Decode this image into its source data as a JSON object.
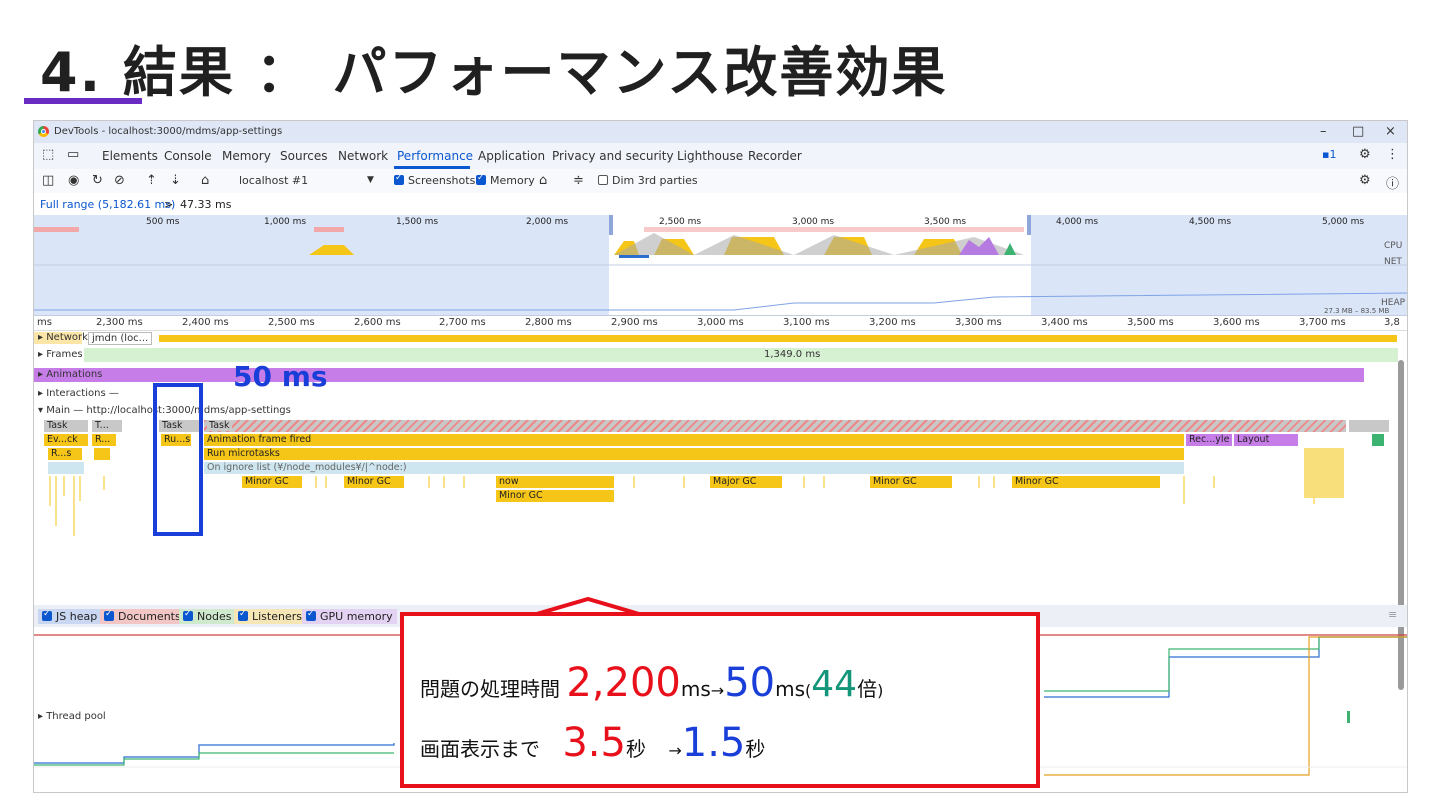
{
  "slide": {
    "title": "4. 結果 ： パフォーマンス改善効果"
  },
  "window": {
    "title": "DevTools - localhost:3000/mdms/app-settings",
    "minimize": "–",
    "maximize": "□",
    "close": "×"
  },
  "tabs": [
    "Elements",
    "Console",
    "Memory",
    "Sources",
    "Network",
    "Performance",
    "Application",
    "Privacy and security",
    "Lighthouse",
    "Recorder"
  ],
  "issues_badge": "1",
  "toolbar": {
    "target": "localhost #1",
    "screenshots": "Screenshots",
    "memory": "Memory",
    "dim_3rd": "Dim 3rd parties"
  },
  "range": {
    "full": "Full range (5,182.61 ms)",
    "sep": ">",
    "selected": "47.33 ms"
  },
  "overview": {
    "ticks": [
      "500 ms",
      "1,000 ms",
      "1,500 ms",
      "2,000 ms",
      "2,500 ms",
      "3,000 ms",
      "3,500 ms",
      "4,000 ms",
      "4,500 ms",
      "5,000 ms"
    ],
    "labels": {
      "cpu": "CPU",
      "net": "NET",
      "heap": "HEAP",
      "heap_range": "27.3 MB – 83.5 MB"
    }
  },
  "ruler": [
    "ms",
    "2,300 ms",
    "2,400 ms",
    "2,500 ms",
    "2,600 ms",
    "2,700 ms",
    "2,800 ms",
    "2,900 ms",
    "3,000 ms",
    "3,100 ms",
    "3,200 ms",
    "3,300 ms",
    "3,400 ms",
    "3,500 ms",
    "3,600 ms",
    "3,700 ms",
    "3,8"
  ],
  "tracks": {
    "network": "Network",
    "network_item": "jmdn (loc...",
    "frames": "Frames",
    "frames_duration": "1,349.0 ms",
    "animations": "Animations",
    "interactions": "Interactions",
    "main": "Main — http://localhost:3000/mdms/app-settings",
    "thread_pool": "Thread pool"
  },
  "flame": {
    "task": "Task",
    "t": "T...",
    "evck": "Ev...ck",
    "r": "R...",
    "rs": "R...s",
    "rus": "Ru...s",
    "anim_frame": "Animation frame fired",
    "run_micro": "Run microtasks",
    "ignore": "On ignore list (¥/node_modules¥/|^node:)",
    "minor_gc": "Minor GC",
    "major_gc": "Major GC",
    "now": "now",
    "recyle": "Rec...yle",
    "layout": "Layout"
  },
  "legend": [
    "JS heap",
    "Documents",
    "Nodes",
    "Listeners",
    "GPU memory"
  ],
  "annotation": {
    "highlight": "50 ms"
  },
  "callout": {
    "line1_prefix": "問題の処理時間",
    "before": "2,200",
    "unit1": "ms",
    "arrow": "→",
    "after": "50",
    "unit2": "ms",
    "paren_open": "(",
    "ratio": "44",
    "ratio_unit": "倍",
    "paren_close": ")",
    "line2_prefix": "画面表示まで",
    "before2": "3.5",
    "sec": "秒",
    "after2": "1.5"
  },
  "colors": {
    "accent": "#0b57d0",
    "highlight_blue": "#1a3fd8",
    "callout_red": "#e8101a",
    "ratio_green": "#13957a",
    "task_yellow": "#f5c518",
    "animation_purple": "#c77de8"
  }
}
